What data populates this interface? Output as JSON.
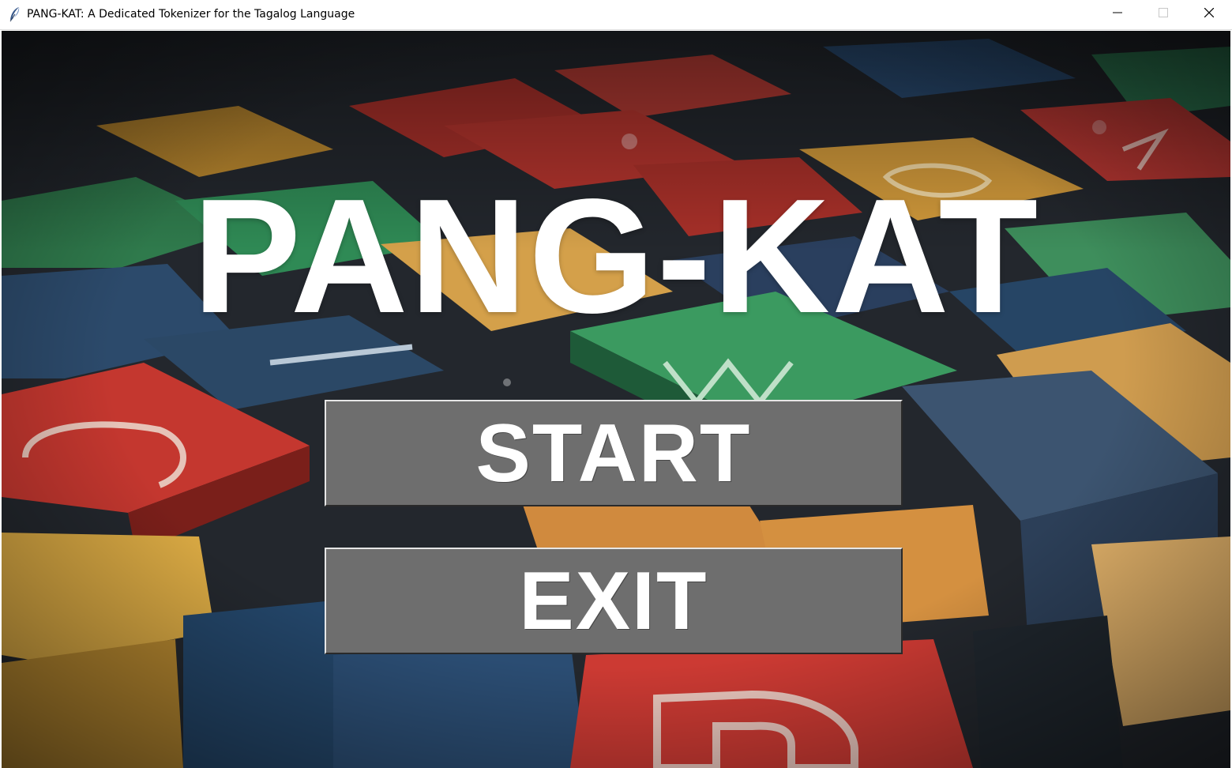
{
  "window": {
    "title": "PANG-KAT: A Dedicated Tokenizer for the Tagalog Language",
    "app_icon": "feather-icon",
    "controls": {
      "minimize_icon": "minimize-icon",
      "maximize_icon": "maximize-icon",
      "close_icon": "close-icon"
    }
  },
  "main": {
    "title": "PANG-KAT",
    "background": "wooden-letter-blocks-image",
    "buttons": {
      "start_label": "START",
      "exit_label": "EXIT"
    }
  },
  "colors": {
    "button_face": "#6e6e6e",
    "button_text": "#ffffff",
    "title_text": "#ffffff",
    "block_red": "#c0362f",
    "block_yellow": "#d9a03c",
    "block_green": "#2f8a55",
    "block_blue": "#2c4a6b",
    "block_orange": "#d4863a"
  }
}
